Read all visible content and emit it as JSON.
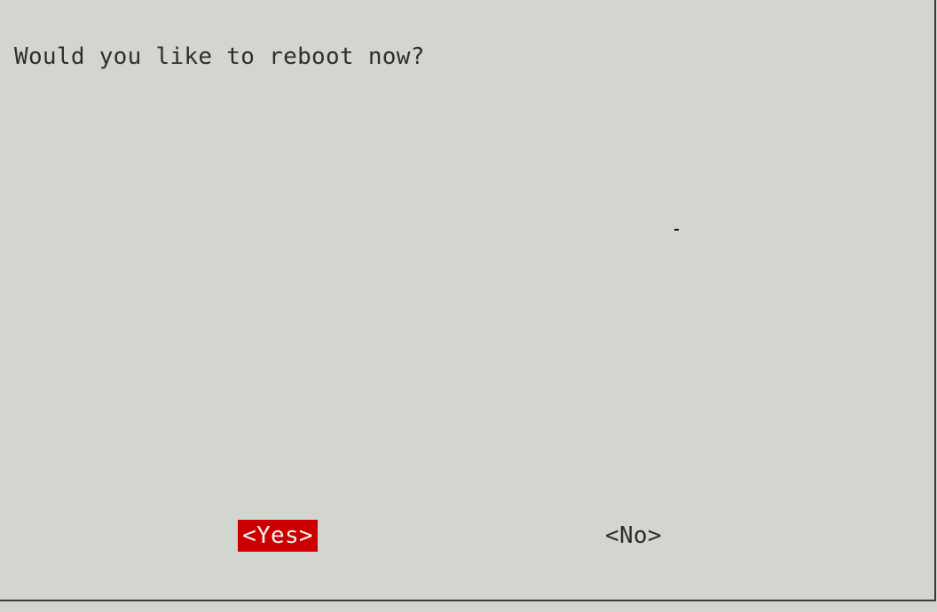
{
  "dialog": {
    "message": "Would you like to reboot now?",
    "buttons": {
      "yes_label": "<Yes>",
      "no_label": "<No>"
    }
  },
  "colors": {
    "background": "#d3d6cf",
    "text": "#2e2e2e",
    "selected_button_bg": "#cc0000",
    "selected_button_text": "#f2f2f2",
    "border": "#3a3a3a"
  }
}
